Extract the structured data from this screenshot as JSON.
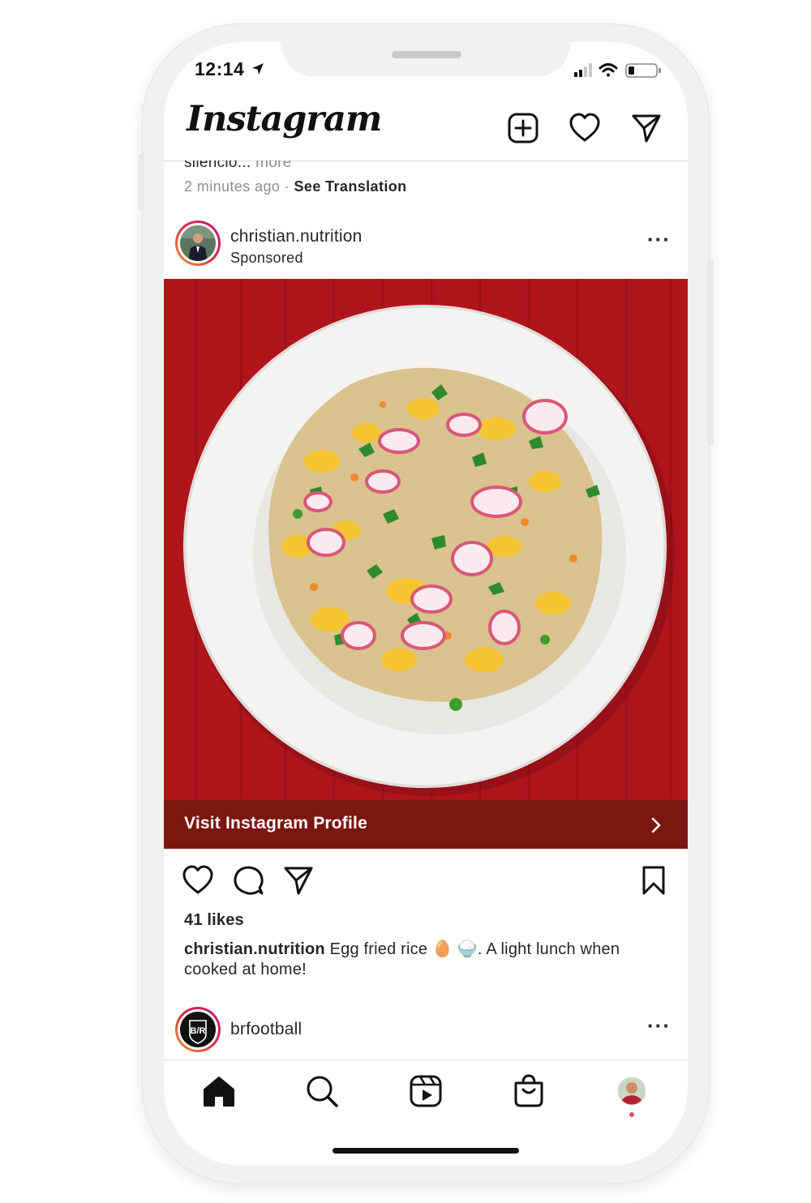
{
  "status_bar": {
    "time": "12:14",
    "icons": [
      "location-arrow-icon",
      "cellular-signal-icon",
      "wifi-icon",
      "battery-icon"
    ]
  },
  "header": {
    "logo_text": "Instagram",
    "icons": [
      "new-post-icon",
      "activity-heart-icon",
      "direct-messages-icon"
    ]
  },
  "previous_post": {
    "caption_fragment": "silencio...",
    "more_label": "more",
    "timestamp": "2 minutes ago",
    "separator": "·",
    "translation_label": "See Translation"
  },
  "post": {
    "username": "christian.nutrition",
    "sponsored_label": "Sponsored",
    "image_description": "bowl-of-egg-fried-rice-with-radish-and-herbs",
    "cta_label": "Visit Instagram Profile",
    "actions": [
      "like-icon",
      "comment-icon",
      "share-icon",
      "save-icon"
    ],
    "likes_text": "41 likes",
    "caption_username": "christian.nutrition",
    "caption_text": "Egg fried rice 🥚 🍚. A light lunch when cooked at home!"
  },
  "next_post": {
    "username": "brfootball",
    "avatar_text": "B/R"
  },
  "bottom_nav": [
    "home-icon",
    "search-icon",
    "reels-icon",
    "shop-icon",
    "profile-avatar"
  ],
  "colors": {
    "cta_background": "#7a1710",
    "notification_dot": "#ed4956",
    "story_ring_start": "#f09433",
    "story_ring_end": "#bc1888"
  }
}
